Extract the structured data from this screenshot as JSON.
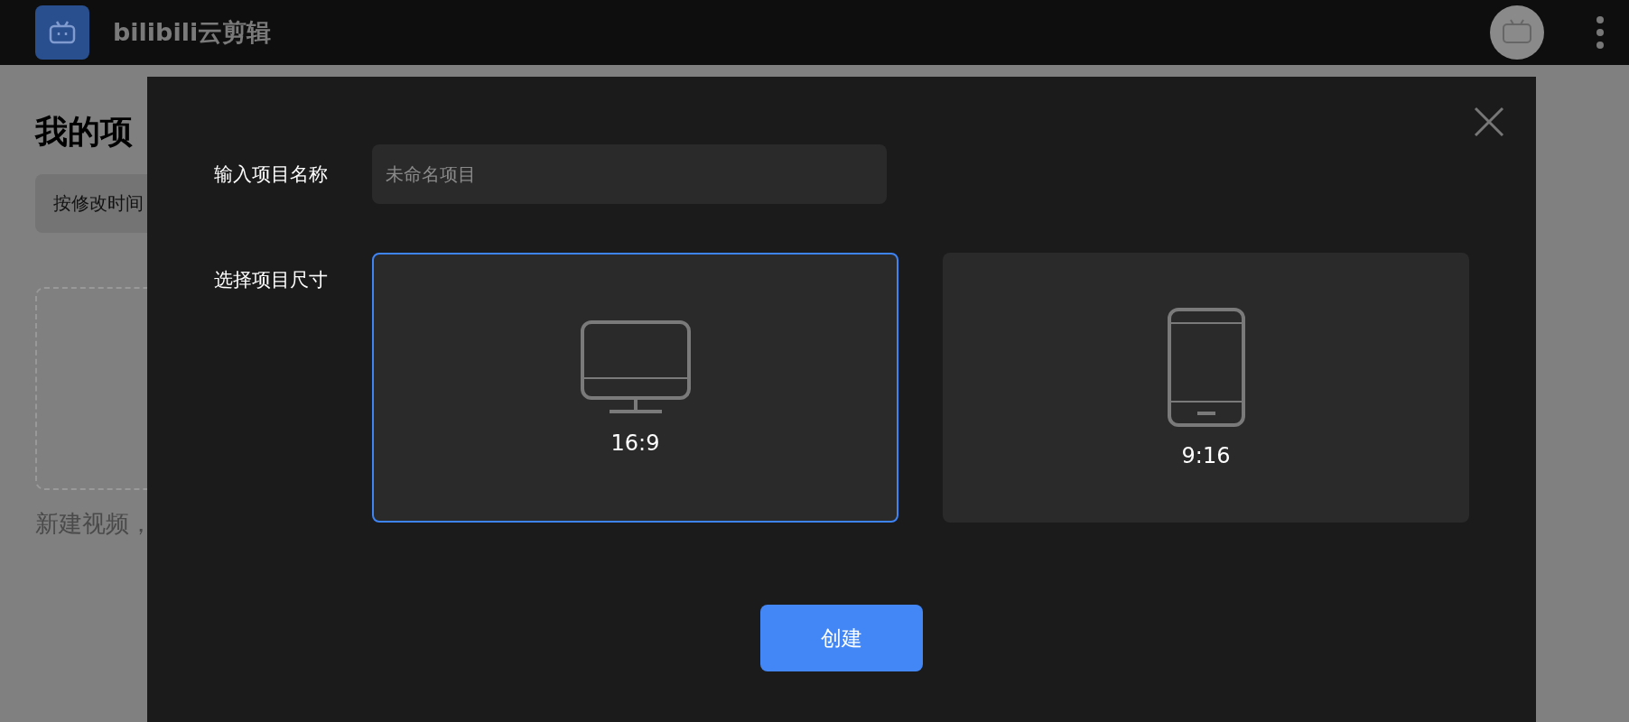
{
  "top_bar": {
    "app_title": "bilibili云剪辑"
  },
  "page": {
    "title": "我的项",
    "sort_button": "按修改时间",
    "new_video_hint": "新建视频，"
  },
  "dialog": {
    "name_label": "输入项目名称",
    "name_field": {
      "placeholder": "未命名项目"
    },
    "size_label": "选择项目尺寸",
    "sizes": [
      {
        "label": "16:9",
        "kind": "landscape",
        "selected": true
      },
      {
        "label": "9:16",
        "kind": "portrait",
        "selected": false
      }
    ],
    "create_button": "创建"
  }
}
